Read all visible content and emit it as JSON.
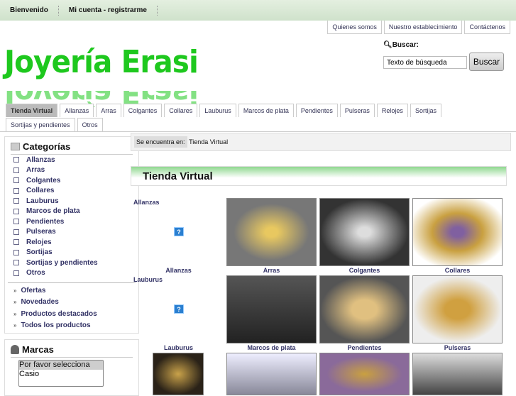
{
  "topbar": {
    "welcome": "Bienvenido",
    "account": "Mi cuenta - registrarme"
  },
  "toplinks": [
    "Quienes somos",
    "Nuestro establecimiento",
    "Contáctenos"
  ],
  "logo": "Joyería Erasi",
  "search": {
    "label": "Buscar:",
    "value": "Texto de búsqueda",
    "button": "Buscar"
  },
  "tabs": [
    "Tienda Virtual",
    "Allanzas",
    "Arras",
    "Colgantes",
    "Collares",
    "Lauburus",
    "Marcos de plata",
    "Pendientes",
    "Pulseras",
    "Relojes",
    "Sortijas",
    "Sortijas y pendientes",
    "Otros"
  ],
  "categories": {
    "title": "Categorías",
    "items": [
      "Allanzas",
      "Arras",
      "Colgantes",
      "Collares",
      "Lauburus",
      "Marcos de plata",
      "Pendientes",
      "Pulseras",
      "Relojes",
      "Sortijas",
      "Sortijas y pendientes",
      "Otros"
    ],
    "links": [
      "Ofertas",
      "Novedades",
      "Productos destacados",
      "Todos los productos"
    ]
  },
  "brands": {
    "title": "Marcas",
    "options": [
      "Por favor selecciona",
      "Casio"
    ]
  },
  "breadcrumb": {
    "label": "Se encuentra en:",
    "current": "Tienda Virtual"
  },
  "page_title": "Tienda Virtual",
  "grid": {
    "row1_label": "Allanzas",
    "row1_caption": "Allanzas",
    "row2_label": "Lauburus",
    "row2_caption": "Lauburus",
    "row1": [
      "Arras",
      "Colgantes",
      "Collares"
    ],
    "row2": [
      "Marcos de plata",
      "Pendientes",
      "Pulseras"
    ],
    "placeholder": "?"
  }
}
